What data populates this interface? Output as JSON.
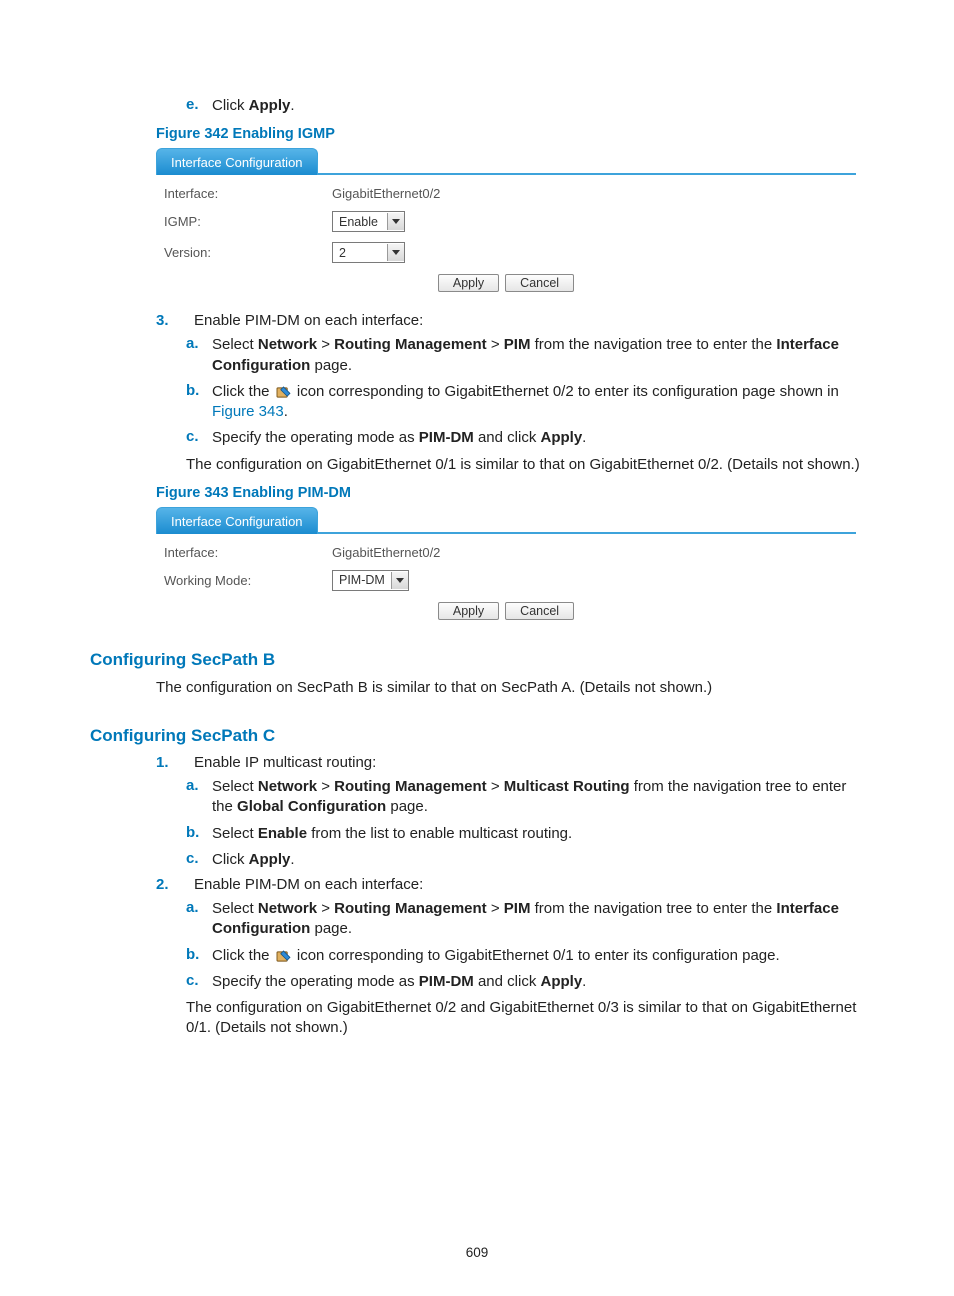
{
  "top_sub_e": {
    "letter": "e.",
    "text_a": "Click ",
    "text_b": "Apply",
    "text_c": "."
  },
  "fig342": {
    "caption": "Figure 342 Enabling IGMP",
    "tab": "Interface Configuration",
    "rows": {
      "iface_label": "Interface:",
      "iface_value": "GigabitEthernet0/2",
      "igmp_label": "IGMP:",
      "igmp_value": "Enable",
      "ver_label": "Version:",
      "ver_value": "2"
    },
    "apply": "Apply",
    "cancel": "Cancel"
  },
  "step3": {
    "num": "3.",
    "text": "Enable PIM-DM on each interface:",
    "a": {
      "letter": "a.",
      "pre": "Select ",
      "n1": "Network",
      "gt1": " > ",
      "n2": "Routing Management",
      "gt2": " > ",
      "n3": "PIM",
      "mid": " from the navigation tree to enter the ",
      "n4": "Interface Configuration",
      "post": " page."
    },
    "b": {
      "letter": "b.",
      "pre": "Click the ",
      "mid": " icon corresponding to GigabitEthernet 0/2 to enter its configuration page shown in ",
      "link": "Figure 343",
      "post": "."
    },
    "c": {
      "letter": "c.",
      "pre": "Specify the operating mode as ",
      "b1": "PIM-DM",
      "mid": " and click ",
      "b2": "Apply",
      "post": "."
    },
    "note": "The configuration on GigabitEthernet 0/1 is similar to that on GigabitEthernet 0/2. (Details not shown.)"
  },
  "fig343": {
    "caption": "Figure 343 Enabling PIM-DM",
    "tab": "Interface Configuration",
    "rows": {
      "iface_label": "Interface:",
      "iface_value": "GigabitEthernet0/2",
      "mode_label": "Working Mode:",
      "mode_value": "PIM-DM"
    },
    "apply": "Apply",
    "cancel": "Cancel"
  },
  "secB": {
    "heading": "Configuring SecPath B",
    "text": "The configuration on SecPath B is similar to that on SecPath A. (Details not shown.)"
  },
  "secC": {
    "heading": "Configuring SecPath C",
    "s1": {
      "num": "1.",
      "text": "Enable IP multicast routing:",
      "a": {
        "letter": "a.",
        "pre": "Select ",
        "n1": "Network",
        "gt1": " > ",
        "n2": "Routing Management",
        "gt2": " > ",
        "n3": "Multicast Routing",
        "mid": " from the navigation tree to enter the ",
        "n4": "Global Configuration",
        "post": " page."
      },
      "b": {
        "letter": "b.",
        "pre": "Select ",
        "b1": "Enable",
        "post": " from the list to enable multicast routing."
      },
      "c": {
        "letter": "c.",
        "pre": "Click ",
        "b1": "Apply",
        "post": "."
      }
    },
    "s2": {
      "num": "2.",
      "text": "Enable PIM-DM on each interface:",
      "a": {
        "letter": "a.",
        "pre": "Select ",
        "n1": "Network",
        "gt1": " > ",
        "n2": "Routing Management",
        "gt2": " > ",
        "n3": "PIM",
        "mid": " from the navigation tree to enter the ",
        "n4": "Interface Configuration",
        "post": " page."
      },
      "b": {
        "letter": "b.",
        "pre": "Click the ",
        "post": " icon corresponding to GigabitEthernet 0/1 to enter its configuration page."
      },
      "c": {
        "letter": "c.",
        "pre": "Specify the operating mode as ",
        "b1": "PIM-DM",
        "mid": " and click ",
        "b2": "Apply",
        "post": "."
      },
      "note": "The configuration on GigabitEthernet 0/2 and GigabitEthernet 0/3 is similar to that on GigabitEthernet 0/1. (Details not shown.)"
    }
  },
  "pagenum": "609"
}
